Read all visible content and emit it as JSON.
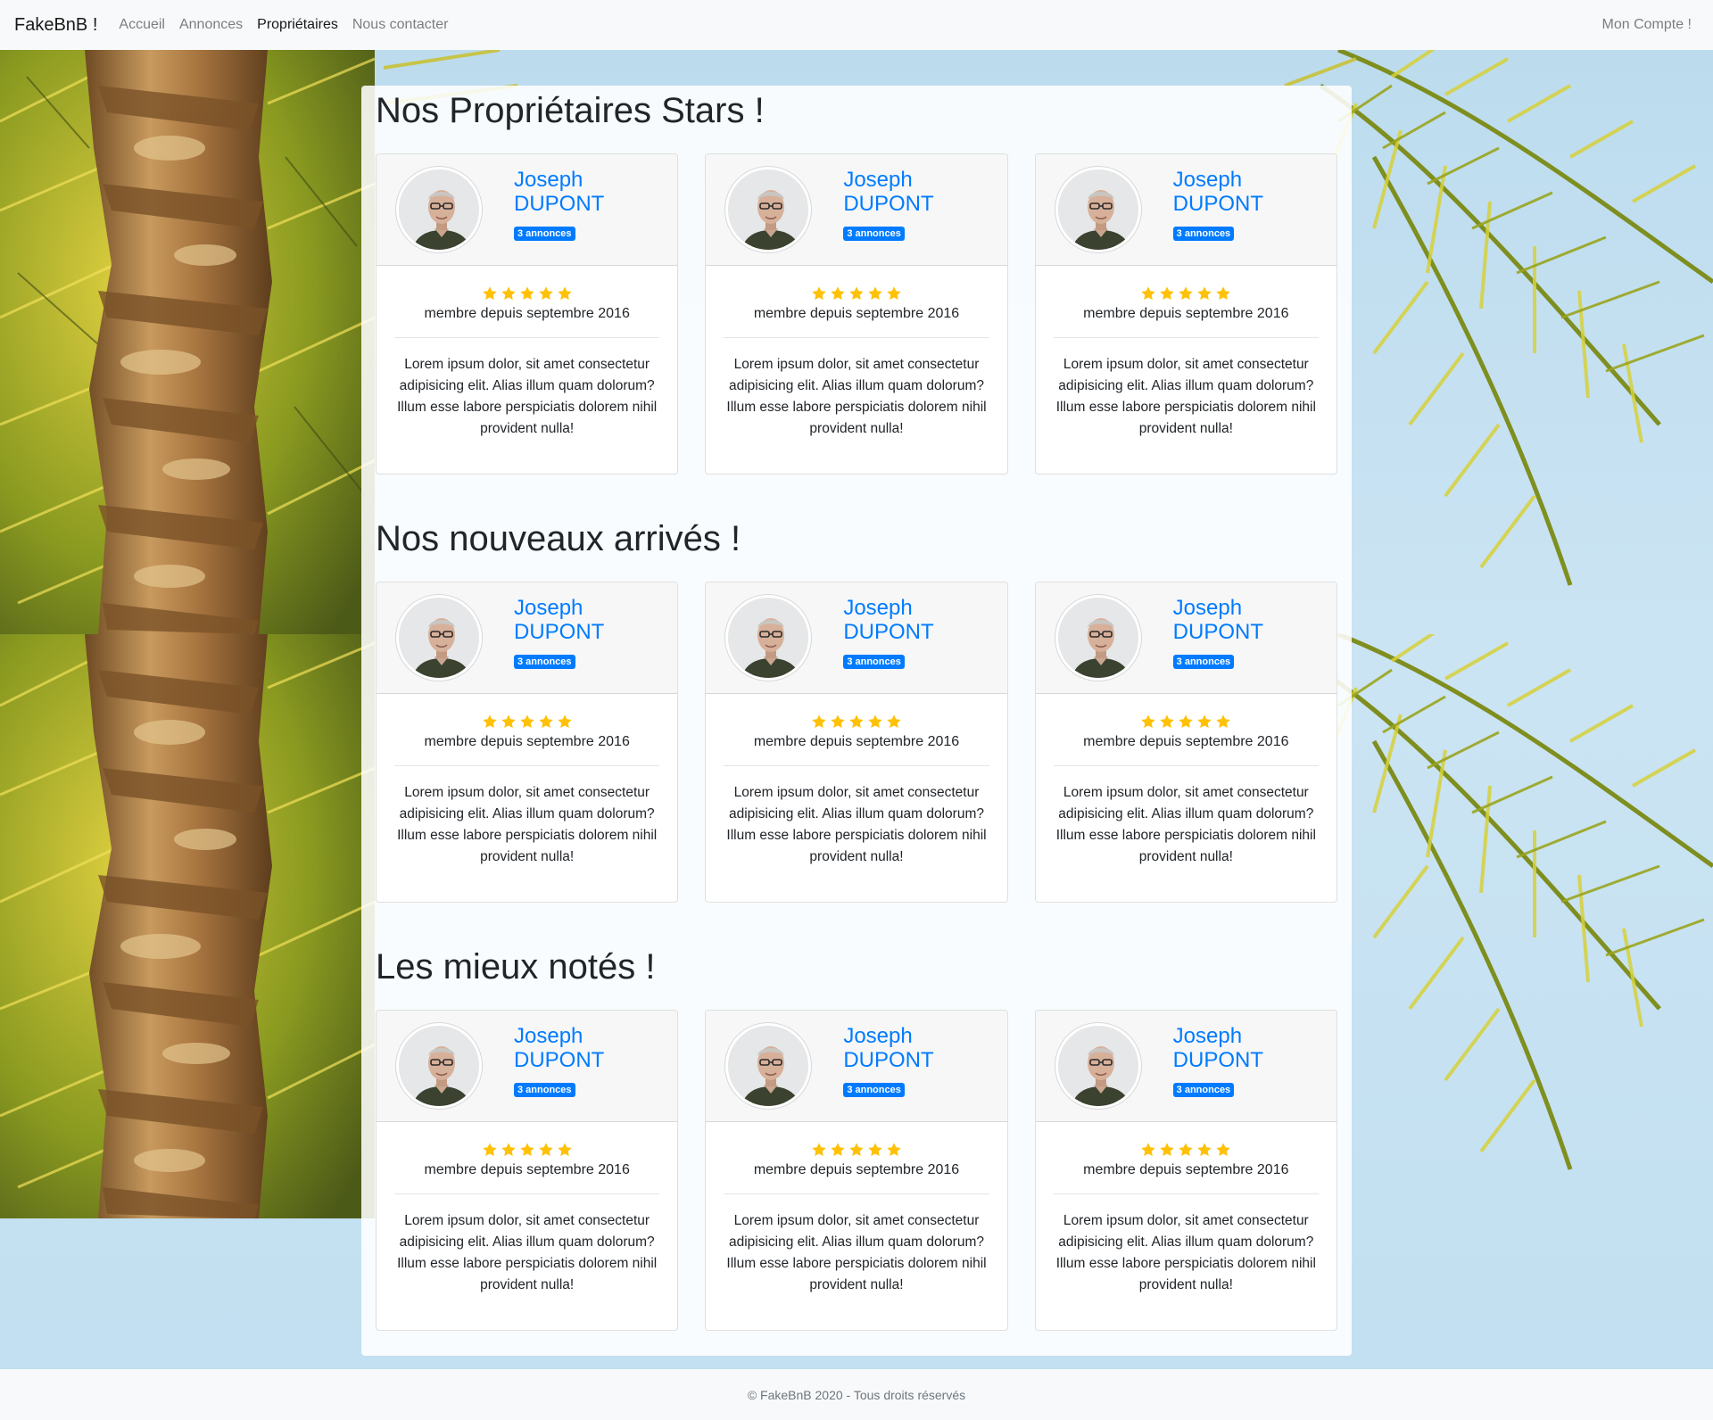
{
  "navbar": {
    "brand": "FakeBnB !",
    "links": [
      {
        "label": "Accueil",
        "active": false
      },
      {
        "label": "Annonces",
        "active": false
      },
      {
        "label": "Propriétaires",
        "active": true
      },
      {
        "label": "Nous contacter",
        "active": false
      }
    ],
    "account": "Mon Compte !"
  },
  "sections": [
    {
      "title": "Nos Propriétaires Stars !",
      "cards": [
        {
          "first_name": "Joseph",
          "last_name": "DUPONT",
          "badge": "3 annonces",
          "rating": 5,
          "since": "membre depuis septembre 2016",
          "description": "Lorem ipsum dolor, sit amet consectetur adipisicing elit. Alias illum quam dolorum? Illum esse labore perspiciatis dolorem nihil provident nulla!"
        },
        {
          "first_name": "Joseph",
          "last_name": "DUPONT",
          "badge": "3 annonces",
          "rating": 5,
          "since": "membre depuis septembre 2016",
          "description": "Lorem ipsum dolor, sit amet consectetur adipisicing elit. Alias illum quam dolorum? Illum esse labore perspiciatis dolorem nihil provident nulla!"
        },
        {
          "first_name": "Joseph",
          "last_name": "DUPONT",
          "badge": "3 annonces",
          "rating": 5,
          "since": "membre depuis septembre 2016",
          "description": "Lorem ipsum dolor, sit amet consectetur adipisicing elit. Alias illum quam dolorum? Illum esse labore perspiciatis dolorem nihil provident nulla!"
        }
      ]
    },
    {
      "title": "Nos nouveaux arrivés !",
      "cards": [
        {
          "first_name": "Joseph",
          "last_name": "DUPONT",
          "badge": "3 annonces",
          "rating": 5,
          "since": "membre depuis septembre 2016",
          "description": "Lorem ipsum dolor, sit amet consectetur adipisicing elit. Alias illum quam dolorum? Illum esse labore perspiciatis dolorem nihil provident nulla!"
        },
        {
          "first_name": "Joseph",
          "last_name": "DUPONT",
          "badge": "3 annonces",
          "rating": 5,
          "since": "membre depuis septembre 2016",
          "description": "Lorem ipsum dolor, sit amet consectetur adipisicing elit. Alias illum quam dolorum? Illum esse labore perspiciatis dolorem nihil provident nulla!"
        },
        {
          "first_name": "Joseph",
          "last_name": "DUPONT",
          "badge": "3 annonces",
          "rating": 5,
          "since": "membre depuis septembre 2016",
          "description": "Lorem ipsum dolor, sit amet consectetur adipisicing elit. Alias illum quam dolorum? Illum esse labore perspiciatis dolorem nihil provident nulla!"
        }
      ]
    },
    {
      "title": "Les mieux notés !",
      "cards": [
        {
          "first_name": "Joseph",
          "last_name": "DUPONT",
          "badge": "3 annonces",
          "rating": 5,
          "since": "membre depuis septembre 2016",
          "description": "Lorem ipsum dolor, sit amet consectetur adipisicing elit. Alias illum quam dolorum? Illum esse labore perspiciatis dolorem nihil provident nulla!"
        },
        {
          "first_name": "Joseph",
          "last_name": "DUPONT",
          "badge": "3 annonces",
          "rating": 5,
          "since": "membre depuis septembre 2016",
          "description": "Lorem ipsum dolor, sit amet consectetur adipisicing elit. Alias illum quam dolorum? Illum esse labore perspiciatis dolorem nihil provident nulla!"
        },
        {
          "first_name": "Joseph",
          "last_name": "DUPONT",
          "badge": "3 annonces",
          "rating": 5,
          "since": "membre depuis septembre 2016",
          "description": "Lorem ipsum dolor, sit amet consectetur adipisicing elit. Alias illum quam dolorum? Illum esse labore perspiciatis dolorem nihil provident nulla!"
        }
      ]
    }
  ],
  "footer": {
    "text": "© FakeBnB 2020 - Tous droits réservés"
  },
  "colors": {
    "link": "#007bff",
    "star": "#ffc107",
    "navbar_bg": "#f8f9fa"
  },
  "icons": {
    "star": "star-icon",
    "avatar": "owner-avatar"
  }
}
